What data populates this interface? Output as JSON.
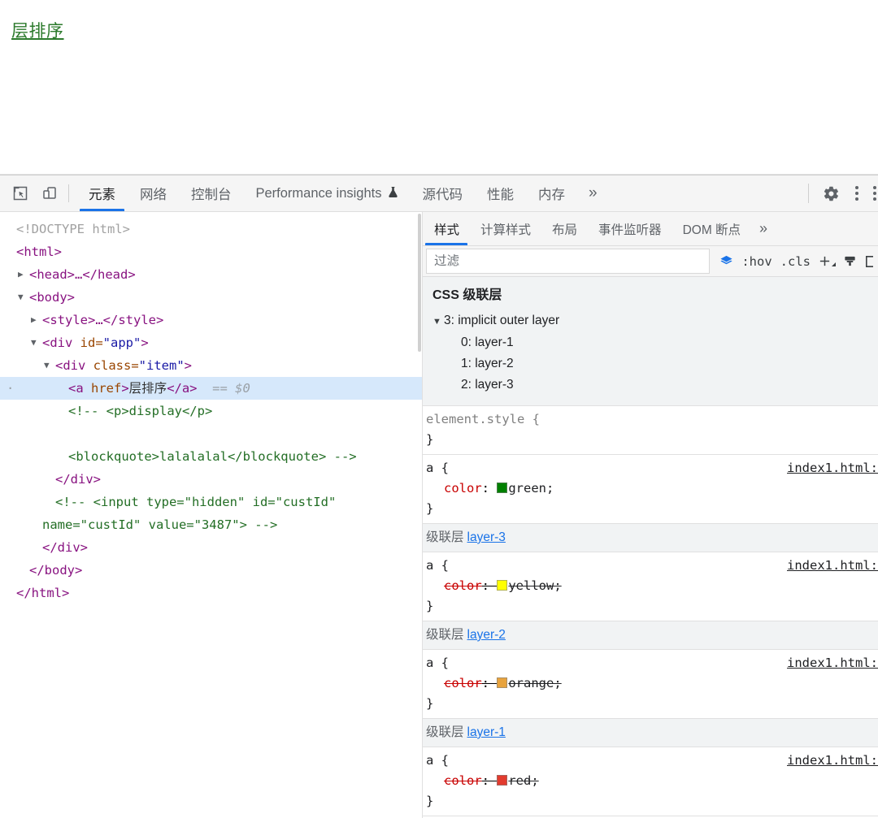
{
  "viewport": {
    "link_text": "层排序",
    "link_color": "#2c7a2c"
  },
  "main_toolbar": {
    "icons": [
      {
        "name": "inspect-element-icon",
        "glyph": "inspect"
      },
      {
        "name": "device-toolbar-icon",
        "glyph": "device"
      }
    ],
    "tabs": [
      {
        "label": "元素",
        "selected": true
      },
      {
        "label": "网络",
        "selected": false
      },
      {
        "label": "控制台",
        "selected": false
      },
      {
        "label": "Performance insights",
        "selected": false,
        "flask": "⚗"
      },
      {
        "label": "源代码",
        "selected": false
      },
      {
        "label": "性能",
        "selected": false
      },
      {
        "label": "内存",
        "selected": false
      }
    ],
    "more_label": "»",
    "settings_icon": "gear-icon",
    "menu_icon": "kebab-menu-icon"
  },
  "dom_tree": {
    "lines": [
      {
        "id": "doctype",
        "indent": 0,
        "tri": "",
        "selected": false,
        "parts": [
          {
            "t": "doctype",
            "s": "<!DOCTYPE html>"
          }
        ]
      },
      {
        "id": "html-open",
        "indent": 0,
        "tri": "",
        "selected": false,
        "parts": [
          {
            "t": "tag",
            "s": "<html>"
          }
        ]
      },
      {
        "id": "head",
        "indent": 1,
        "tri": "▶",
        "selected": false,
        "parts": [
          {
            "t": "tag",
            "s": "<head>"
          },
          {
            "t": "ellip",
            "s": "…"
          },
          {
            "t": "tag",
            "s": "</head>"
          }
        ]
      },
      {
        "id": "body-open",
        "indent": 1,
        "tri": "▼",
        "selected": false,
        "parts": [
          {
            "t": "tag",
            "s": "<body>"
          }
        ]
      },
      {
        "id": "style",
        "indent": 2,
        "tri": "▶",
        "selected": false,
        "parts": [
          {
            "t": "tag",
            "s": "<style>"
          },
          {
            "t": "ellip",
            "s": "…"
          },
          {
            "t": "tag",
            "s": "</style>"
          }
        ]
      },
      {
        "id": "div-app",
        "indent": 2,
        "tri": "▼",
        "selected": false,
        "parts": [
          {
            "t": "tag",
            "s": "<div "
          },
          {
            "t": "attrn",
            "s": "id="
          },
          {
            "t": "attrv",
            "s": "\"app\""
          },
          {
            "t": "tag",
            "s": ">"
          }
        ]
      },
      {
        "id": "div-item",
        "indent": 3,
        "tri": "▼",
        "selected": false,
        "parts": [
          {
            "t": "tag",
            "s": "<div "
          },
          {
            "t": "attrn",
            "s": "class="
          },
          {
            "t": "attrv",
            "s": "\"item\""
          },
          {
            "t": "tag",
            "s": ">"
          }
        ]
      },
      {
        "id": "a-node",
        "indent": 4,
        "tri": "",
        "selected": true,
        "parts": [
          {
            "t": "tag",
            "s": "<a "
          },
          {
            "t": "attrn",
            "s": "href"
          },
          {
            "t": "tag",
            "s": ">"
          },
          {
            "t": "text",
            "s": "层排序"
          },
          {
            "t": "tag",
            "s": "</a>"
          },
          {
            "t": "eq0",
            "s": "  == $0"
          }
        ]
      },
      {
        "id": "comment-1",
        "indent": 4,
        "tri": "",
        "selected": false,
        "parts": [
          {
            "t": "comment",
            "s": "<!-- <p>display</p>"
          }
        ]
      },
      {
        "id": "comment-blank",
        "indent": 4,
        "tri": "",
        "selected": false,
        "parts": [
          {
            "t": "comment",
            "s": " "
          }
        ]
      },
      {
        "id": "comment-2",
        "indent": 4,
        "tri": "",
        "selected": false,
        "parts": [
          {
            "t": "comment",
            "s": "<blockquote>lalalalal</blockquote> -->"
          }
        ]
      },
      {
        "id": "div-item-close",
        "indent": 3,
        "tri": "",
        "selected": false,
        "parts": [
          {
            "t": "tag",
            "s": "</div>"
          }
        ]
      },
      {
        "id": "comment-3a",
        "indent": 3,
        "tri": "",
        "selected": false,
        "parts": [
          {
            "t": "comment",
            "s": "<!-- <input type=\"hidden\" id=\"custId\""
          }
        ]
      },
      {
        "id": "comment-3b",
        "indent": 2,
        "tri": "",
        "selected": false,
        "parts": [
          {
            "t": "comment",
            "s": "name=\"custId\" value=\"3487\"> -->"
          }
        ]
      },
      {
        "id": "div-app-close",
        "indent": 2,
        "tri": "",
        "selected": false,
        "parts": [
          {
            "t": "tag",
            "s": "</div>"
          }
        ]
      },
      {
        "id": "body-close",
        "indent": 1,
        "tri": "",
        "selected": false,
        "parts": [
          {
            "t": "tag",
            "s": "</body>"
          }
        ]
      },
      {
        "id": "html-close",
        "indent": 0,
        "tri": "",
        "selected": false,
        "parts": [
          {
            "t": "tag",
            "s": "</html>"
          }
        ]
      }
    ]
  },
  "styles_panel": {
    "tabs": [
      {
        "label": "样式",
        "selected": true
      },
      {
        "label": "计算样式",
        "selected": false
      },
      {
        "label": "布局",
        "selected": false
      },
      {
        "label": "事件监听器",
        "selected": false
      },
      {
        "label": "DOM 断点",
        "selected": false
      }
    ],
    "more_label": "»",
    "filter": {
      "value": "",
      "placeholder": "过滤"
    },
    "actions": [
      {
        "name": "toggle-layers-icon",
        "label": "≋"
      },
      {
        "name": "hover-state-button",
        "label": ":hov"
      },
      {
        "name": "class-filter-button",
        "label": ".cls"
      },
      {
        "name": "new-style-rule-button",
        "label": "+"
      },
      {
        "name": "print-media-button",
        "label": "🖌"
      },
      {
        "name": "computed-sidebar-button",
        "label": "["
      }
    ],
    "cascade": {
      "title": "CSS 级联层",
      "root": {
        "tri": "▼",
        "label": "3: implicit outer layer"
      },
      "children": [
        {
          "label": "0: layer-1"
        },
        {
          "label": "1: layer-2"
        },
        {
          "label": "2: layer-3"
        }
      ]
    },
    "rules": [
      {
        "kind": "rule",
        "selector": "element.style",
        "inline": true,
        "origin": "",
        "decls": []
      },
      {
        "kind": "rule",
        "selector": "a",
        "inline": false,
        "origin": "index1.html:",
        "decls": [
          {
            "prop": "color",
            "value": "green",
            "swatch": "#008000",
            "overridden": false
          }
        ]
      },
      {
        "kind": "layer",
        "label": "级联层",
        "link": "layer-3"
      },
      {
        "kind": "rule",
        "selector": "a",
        "inline": false,
        "origin": "index1.html:",
        "decls": [
          {
            "prop": "color",
            "value": "yellow",
            "swatch": "#ffff00",
            "overridden": true
          }
        ]
      },
      {
        "kind": "layer",
        "label": "级联层",
        "link": "layer-2"
      },
      {
        "kind": "rule",
        "selector": "a",
        "inline": false,
        "origin": "index1.html:",
        "decls": [
          {
            "prop": "color",
            "value": "orange",
            "swatch": "#e8a33d",
            "overridden": true
          }
        ]
      },
      {
        "kind": "layer",
        "label": "级联层",
        "link": "layer-1"
      },
      {
        "kind": "rule",
        "selector": "a",
        "inline": false,
        "origin": "index1.html:",
        "decls": [
          {
            "prop": "color",
            "value": "red",
            "swatch": "#e23b2e",
            "overridden": true
          }
        ]
      }
    ]
  }
}
